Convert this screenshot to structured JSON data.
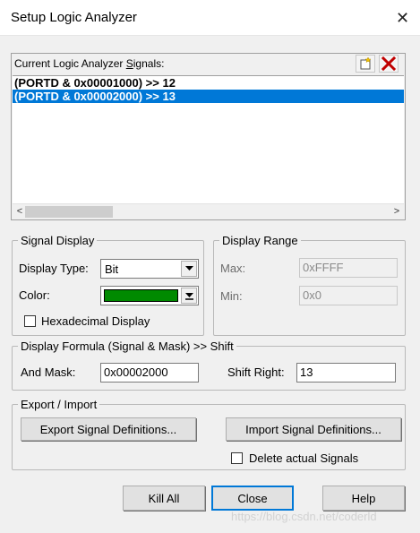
{
  "window": {
    "title": "Setup Logic Analyzer",
    "close_glyph": "✕"
  },
  "signals": {
    "label_prefix": "Current Logic Analyzer ",
    "label_underlined": "S",
    "label_suffix": "ignals:",
    "items": [
      {
        "text": "(PORTD & 0x00001000) >> 12",
        "selected": false
      },
      {
        "text": "(PORTD & 0x00002000) >> 13",
        "selected": true
      }
    ],
    "new_icon": "new-signal-icon",
    "delete_icon": "delete-signal-icon",
    "scroll_left": "<",
    "scroll_right": ">"
  },
  "signal_display": {
    "group_title": "Signal Display",
    "display_type_label": "Display Type:",
    "display_type_value": "Bit",
    "color_label": "Color:",
    "color_value": "#008a00",
    "hex_label": "Hexadecimal Display",
    "hex_checked": false
  },
  "display_range": {
    "group_title": "Display Range",
    "max_label": "Max:",
    "max_value": "0xFFFF",
    "min_label": "Min:",
    "min_value": "0x0"
  },
  "formula": {
    "group_title": "Display Formula (Signal & Mask) >> Shift",
    "and_mask_label": "And Mask:",
    "and_mask_value": "0x00002000",
    "shift_right_label": "Shift Right:",
    "shift_right_value": "13"
  },
  "export_import": {
    "group_title": "Export / Import",
    "export_button": "Export Signal Definitions...",
    "import_button": "Import Signal Definitions...",
    "delete_label": "Delete actual Signals",
    "delete_checked": false
  },
  "buttons": {
    "kill_all": "Kill All",
    "close": "Close",
    "help": "Help"
  },
  "watermark": "https://blog.csdn.net/coderld"
}
